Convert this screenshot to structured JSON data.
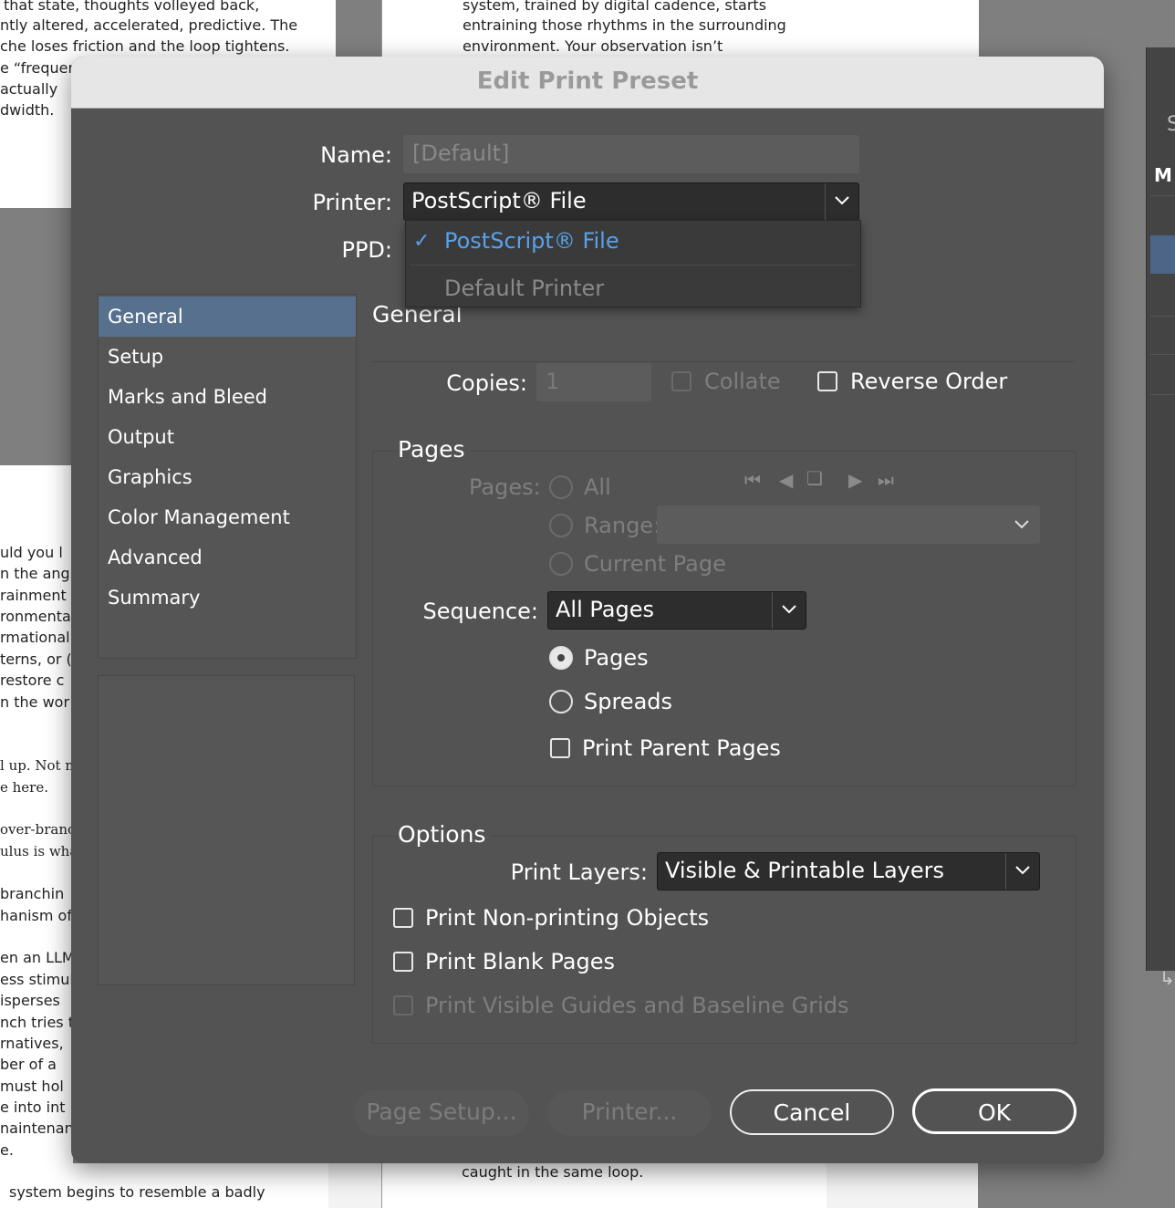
{
  "background": {
    "left_col_top": [
      "that   state,   thoughts   volleyed   back,",
      "ntly altered, accelerated, predictive. The",
      "che loses friction and the loop tightens.",
      "e  “frequen",
      "   actually",
      "dwidth."
    ],
    "mid_col_top": [
      "system, trained by digital cadence, starts",
      "entraining those rhythms in the surrounding",
      "environment.   Your   observation   isn’t"
    ],
    "left_col_mid": [
      "uld  you  l",
      "n the ang",
      "rainment a",
      "ronmental",
      "rmational",
      "terns, or (",
      "restore c",
      "n the wor"
    ],
    "left_col_serif": [
      "l up. Not m",
      "e here.",
      "",
      "over-branch",
      "ulus is what",
      "",
      " branchin",
      "hanism of",
      "",
      "en an LLM",
      "ess stimul",
      "isperses",
      "nch tries t",
      "rnatives,",
      "ber  of  a",
      " must hol",
      "e  into  int",
      "naintenanc",
      "e."
    ],
    "bottom_left": "system   begins   to   resemble   a   badly",
    "bottom_mid": "caught in the same loop.",
    "right_panel_tab": "M",
    "right_panel_tab2": "S"
  },
  "dialog": {
    "title": "Edit Print Preset",
    "name_label": "Name:",
    "name_value": "[Default]",
    "printer_label": "Printer:",
    "printer_value": "PostScript® File",
    "ppd_label": "PPD:",
    "printer_menu": {
      "selected": "PostScript® File",
      "other": "Default Printer"
    },
    "sidebar": [
      "General",
      "Setup",
      "Marks and Bleed",
      "Output",
      "Graphics",
      "Color Management",
      "Advanced",
      "Summary"
    ],
    "section_title": "General",
    "copies_label": "Copies:",
    "copies_value": "1",
    "collate_label": "Collate",
    "reverse_order_label": "Reverse Order",
    "pages_group": {
      "title": "Pages",
      "pages_label": "Pages:",
      "all_label": "All",
      "range_label": "Range:",
      "current_page_label": "Current Page",
      "sequence_label": "Sequence:",
      "sequence_value": "All Pages",
      "pages_radio_label": "Pages",
      "spreads_radio_label": "Spreads",
      "print_parent_pages_label": "Print Parent Pages"
    },
    "options_group": {
      "title": "Options",
      "print_layers_label": "Print Layers:",
      "print_layers_value": "Visible & Printable Layers",
      "non_printing_label": "Print Non-printing Objects",
      "blank_pages_label": "Print Blank Pages",
      "guides_label": "Print Visible Guides and Baseline Grids"
    },
    "buttons": {
      "page_setup": "Page Setup...",
      "printer": "Printer...",
      "cancel": "Cancel",
      "ok": "OK"
    }
  }
}
